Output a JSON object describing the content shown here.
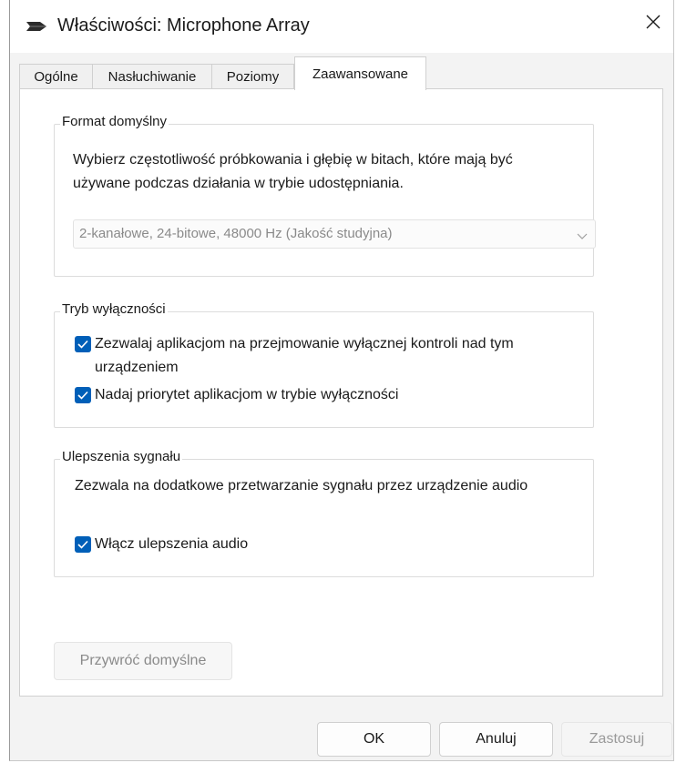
{
  "window": {
    "title": "Właściwości: Microphone Array",
    "close_glyph": "✕"
  },
  "tabs": [
    {
      "label": "Ogólne",
      "active": false
    },
    {
      "label": "Nasłuchiwanie",
      "active": false
    },
    {
      "label": "Poziomy",
      "active": false
    },
    {
      "label": "Zaawansowane",
      "active": true
    }
  ],
  "default_format": {
    "group_label": "Format domyślny",
    "description_line1": "Wybierz częstotliwość próbkowania i głębię w bitach, które mają być",
    "description_line2": "używane podczas działania w trybie udostępniania.",
    "selected_value": "2-kanałowe, 24-bitowe, 48000 Hz (Jakość studyjna)",
    "enabled": false
  },
  "exclusive_mode": {
    "group_label": "Tryb wyłączności",
    "checkboxes": [
      {
        "line1": "Zezwalaj aplikacjom na przejmowanie wyłącznej kontroli nad tym",
        "line2": "urządzeniem",
        "checked": true
      },
      {
        "line1": "Nadaj priorytet aplikacjom w trybie wyłączności",
        "line2": "",
        "checked": true
      }
    ]
  },
  "signal_enhancements": {
    "group_label": "Ulepszenia sygnału",
    "description": "Zezwala na dodatkowe przetwarzanie sygnału przez urządzenie audio",
    "checkbox": {
      "label": "Włącz ulepszenia audio",
      "checked": true
    }
  },
  "buttons": {
    "restore_defaults": "Przywróć domyślne",
    "ok": "OK",
    "cancel": "Anuluj",
    "apply": "Zastosuj"
  },
  "colors": {
    "accent": "#005fb8",
    "disabled_text": "#8a8a8a"
  }
}
